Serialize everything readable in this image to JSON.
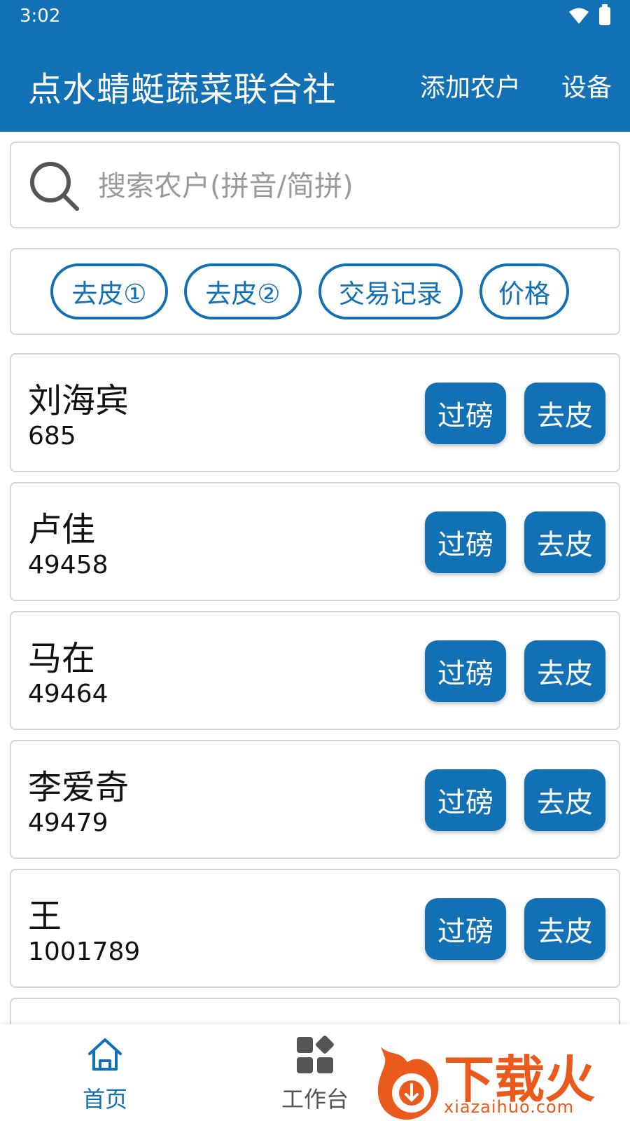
{
  "theme": {
    "primary": "#1270b4",
    "accent": "#e95a1c"
  },
  "status_bar": {
    "time": "3:02",
    "icons": [
      "wifi-icon",
      "battery-icon"
    ]
  },
  "app_bar": {
    "title": "点水蜻蜓蔬菜联合社",
    "add_farmer": "添加农户",
    "device": "设备"
  },
  "search": {
    "placeholder": "搜索农户(拼音/简拼)",
    "value": ""
  },
  "quick_actions": [
    "去皮①",
    "去皮②",
    "交易记录",
    "价格"
  ],
  "farmers": [
    {
      "name": "刘海宾",
      "code": "685"
    },
    {
      "name": "卢佳",
      "code": "49458"
    },
    {
      "name": "马在",
      "code": "49464"
    },
    {
      "name": "李爱奇",
      "code": "49479"
    },
    {
      "name": "王",
      "code": "1001789"
    }
  ],
  "card_buttons": {
    "weigh": "过磅",
    "tare": "去皮"
  },
  "bottom_nav": {
    "home": "首页",
    "workbench": "工作台"
  },
  "watermark": {
    "text": "下载火",
    "url": "xiazaihuo.com"
  }
}
